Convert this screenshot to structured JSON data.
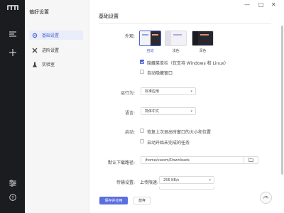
{
  "leftbar": {
    "icons": [
      "logo-icon",
      "menu-icon",
      "add-icon",
      "settings-sliders-icon",
      "help-icon"
    ]
  },
  "sidebar": {
    "title": "偏好设置",
    "items": [
      {
        "label": "基础设置",
        "icon": "gear-icon",
        "active": true
      },
      {
        "label": "进阶设置",
        "icon": "wrench-icon",
        "active": false
      },
      {
        "label": "实验室",
        "icon": "flask-icon",
        "active": false
      }
    ]
  },
  "main": {
    "title": "基础设置",
    "appearance": {
      "label": "外观:",
      "options": [
        {
          "label": "自动",
          "selected": true
        },
        {
          "label": "浅色",
          "selected": false
        },
        {
          "label": "深色",
          "selected": false
        }
      ],
      "hide_menubar": {
        "label": "隐藏菜单栏（仅支持 Windows 和 Linux）",
        "checked": true
      },
      "auto_hide_window": {
        "label": "自动隐藏窗口",
        "checked": false
      }
    },
    "run_as": {
      "label": "运行为:",
      "value": "标准应用"
    },
    "language": {
      "label": "语言:",
      "value": "简体中文"
    },
    "startup": {
      "label": "启动:",
      "restore_window": {
        "label": "恢复上次退出时窗口的大小和位置",
        "checked": false
      },
      "auto_resume": {
        "label": "自动开始未完成的任务",
        "checked": false
      }
    },
    "download_path": {
      "label": "默认下载路径:",
      "value": "/home/vsesm/Downloads"
    },
    "transfer": {
      "label": "传输设置:",
      "upload_label": "上传限速:",
      "upload_value": "256 KB/s"
    },
    "buttons": {
      "save": "保存并应用",
      "discard": "放弃"
    }
  },
  "colors": {
    "accent": "#4e61d6",
    "leftbar_bg": "#1b1c1f"
  }
}
